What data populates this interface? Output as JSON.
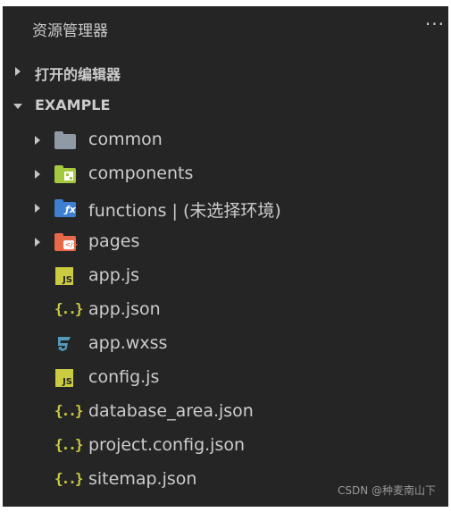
{
  "panel": {
    "title": "资源管理器",
    "more_label": "···"
  },
  "sections": {
    "open_editors": "打开的编辑器",
    "workspace": "EXAMPLE"
  },
  "tree": [
    {
      "name": "common",
      "type": "folder",
      "icon": "folder-icon",
      "color": "#8f9aa6"
    },
    {
      "name": "components",
      "type": "folder",
      "icon": "components-folder-icon",
      "color": "#a5c93c"
    },
    {
      "name": "functions | (未选择环境)",
      "type": "folder",
      "icon": "functions-folder-icon",
      "color": "#3d7fd1"
    },
    {
      "name": "pages",
      "type": "folder",
      "icon": "pages-folder-icon",
      "color": "#e8684a"
    },
    {
      "name": "app.js",
      "type": "file",
      "icon": "js-file-icon"
    },
    {
      "name": "app.json",
      "type": "file",
      "icon": "json-file-icon"
    },
    {
      "name": "app.wxss",
      "type": "file",
      "icon": "css-file-icon"
    },
    {
      "name": "config.js",
      "type": "file",
      "icon": "js-file-icon"
    },
    {
      "name": "database_area.json",
      "type": "file",
      "icon": "json-file-icon"
    },
    {
      "name": "project.config.json",
      "type": "file",
      "icon": "json-file-icon"
    },
    {
      "name": "sitemap.json",
      "type": "file",
      "icon": "json-file-icon"
    }
  ],
  "watermark": "CSDN @种麦南山下",
  "colors": {
    "background": "#252526",
    "text": "#cccccc",
    "js": "#cbcb41",
    "css": "#519aba"
  }
}
